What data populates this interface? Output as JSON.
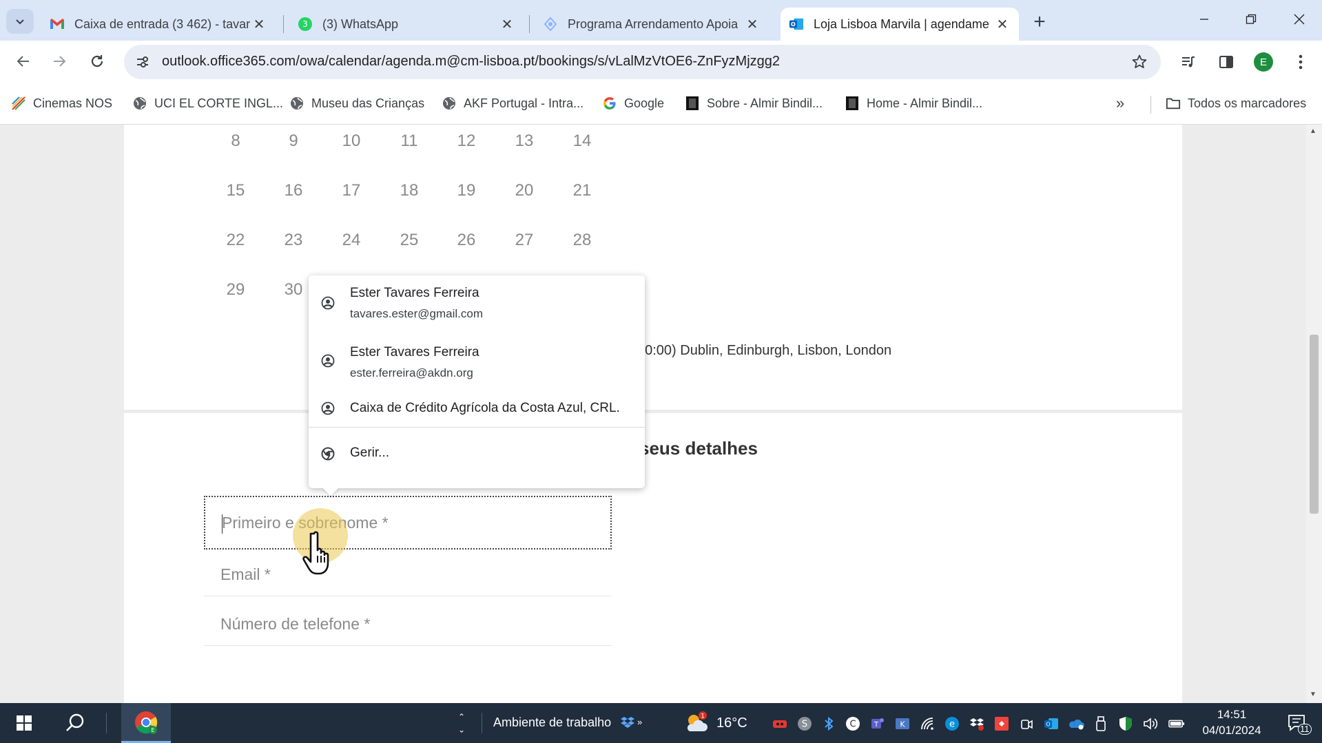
{
  "browser": {
    "tabs": [
      {
        "title": "Caixa de entrada (3 462) - tavar",
        "favicon": "gmail-icon"
      },
      {
        "title": "(3) WhatsApp",
        "favicon": "whatsapp-icon",
        "badge": "3"
      },
      {
        "title": "Programa Arrendamento Apoia",
        "favicon": "program-icon"
      },
      {
        "title": "Loja Lisboa Marvila | agendame",
        "favicon": "outlook-icon",
        "active": true
      }
    ],
    "url": "outlook.office365.com/owa/calendar/agenda.m@cm-lisboa.pt/bookings/s/vLalMzVtOE6-ZnFyzMjzgg2",
    "profile_initial": "E",
    "bookmarks": [
      {
        "label": "Cinemas NOS",
        "icon": "nos-icon"
      },
      {
        "label": "UCI EL CORTE INGL...",
        "icon": "globe-icon"
      },
      {
        "label": "Museu das Crianças",
        "icon": "globe-icon"
      },
      {
        "label": "AKF Portugal - Intra...",
        "icon": "globe-icon"
      },
      {
        "label": "Google",
        "icon": "google-icon"
      },
      {
        "label": "Sobre - Almir Bindil...",
        "icon": "page-icon"
      },
      {
        "label": "Home - Almir Bindil...",
        "icon": "page-icon"
      }
    ],
    "all_bookmarks_label": "Todos os marcadores"
  },
  "calendar": {
    "rows": [
      [
        "8",
        "9",
        "10",
        "11",
        "12",
        "13",
        "14"
      ],
      [
        "15",
        "16",
        "17",
        "18",
        "19",
        "20",
        "21"
      ],
      [
        "22",
        "23",
        "24",
        "25",
        "26",
        "27",
        "28"
      ],
      [
        "29",
        "30"
      ]
    ],
    "timezone_text": "00:00) Dublin, Edinburgh, Lisbon, London"
  },
  "details": {
    "section_title_visible": "seus detalhes",
    "name_placeholder": "Primeiro e sobrenome *",
    "email_placeholder": "Email *",
    "phone_placeholder": "Número de telefone *"
  },
  "autofill": {
    "items": [
      {
        "name": "Ester Tavares Ferreira",
        "email": "tavares.ester@gmail.com"
      },
      {
        "name": "Ester Tavares Ferreira",
        "email": "ester.ferreira@akdn.org"
      },
      {
        "name": "Caixa de Crédito Agrícola da Costa Azul, CRL.",
        "email": ""
      }
    ],
    "manage_label": "Gerir..."
  },
  "taskbar": {
    "desktop_label": "Ambiente de trabalho",
    "weather_temp": "16°C",
    "weather_badge": "1",
    "time": "14:51",
    "date": "04/01/2024",
    "notifications_count": "11"
  },
  "colors": {
    "tabstrip": "#dbe6f7",
    "omnibox": "#e9eef6",
    "taskbar": "#1f2d3d",
    "page_bg": "#ececec"
  }
}
